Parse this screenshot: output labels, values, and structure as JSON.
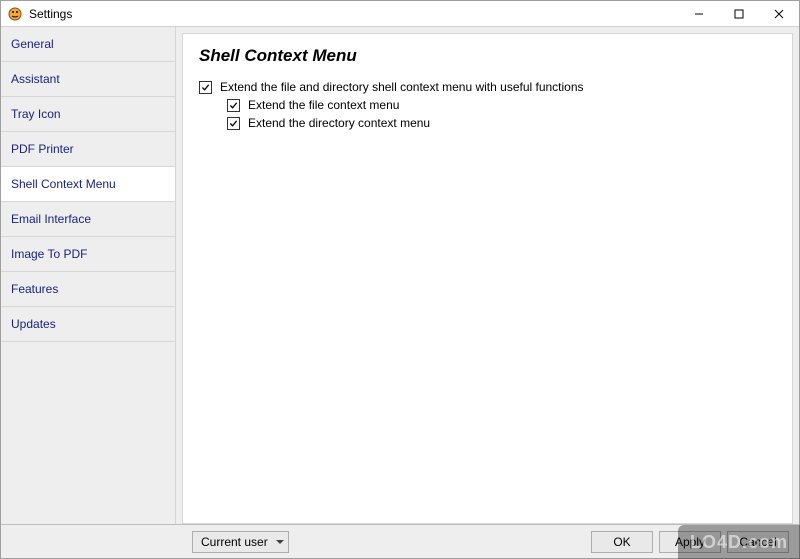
{
  "window": {
    "title": "Settings"
  },
  "sidebar": {
    "items": [
      {
        "label": "General"
      },
      {
        "label": "Assistant"
      },
      {
        "label": "Tray Icon"
      },
      {
        "label": "PDF Printer"
      },
      {
        "label": "Shell Context Menu",
        "selected": true
      },
      {
        "label": "Email Interface"
      },
      {
        "label": "Image To PDF"
      },
      {
        "label": "Features"
      },
      {
        "label": "Updates"
      }
    ]
  },
  "content": {
    "heading": "Shell Context Menu",
    "options": {
      "extend_main": {
        "label": "Extend the file and directory shell context menu with useful functions",
        "checked": true
      },
      "extend_file": {
        "label": "Extend the file context menu",
        "checked": true
      },
      "extend_dir": {
        "label": "Extend the directory context menu",
        "checked": true
      }
    }
  },
  "footer": {
    "scope_selected": "Current user",
    "buttons": {
      "ok": "OK",
      "apply": "Apply",
      "cancel": "Cancel"
    }
  },
  "watermark": "LO4D.com"
}
